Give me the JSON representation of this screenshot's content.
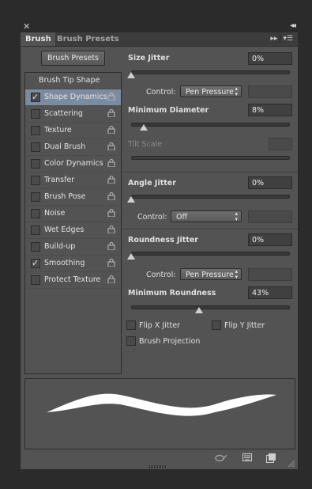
{
  "panel": {
    "close_glyph": "✕",
    "collapse_glyph": "◂◂",
    "tabs": [
      {
        "label": "Brush",
        "active": true
      },
      {
        "label": "Brush Presets",
        "active": false
      }
    ],
    "menu_glyph": "▸▸"
  },
  "brush_presets_button": "Brush Presets",
  "list": {
    "header": "Brush Tip Shape",
    "items": [
      {
        "label": "Shape Dynamics",
        "checked": true,
        "selected": true
      },
      {
        "label": "Scattering",
        "checked": false
      },
      {
        "label": "Texture",
        "checked": false
      },
      {
        "label": "Dual Brush",
        "checked": false
      },
      {
        "label": "Color Dynamics",
        "checked": false
      },
      {
        "label": "Transfer",
        "checked": false
      },
      {
        "label": "Brush Pose",
        "checked": false
      },
      {
        "label": "Noise",
        "checked": false
      },
      {
        "label": "Wet Edges",
        "checked": false
      },
      {
        "label": "Build-up",
        "checked": false
      },
      {
        "label": "Smoothing",
        "checked": true
      },
      {
        "label": "Protect Texture",
        "checked": false
      }
    ]
  },
  "settings": {
    "size_jitter": {
      "label": "Size Jitter",
      "value": "0%",
      "slider": 0.0
    },
    "size_control": {
      "label": "Control:",
      "value": "Pen Pressure"
    },
    "min_diameter": {
      "label": "Minimum Diameter",
      "value": "8%",
      "slider": 0.08
    },
    "tilt_scale": {
      "label": "Tilt Scale",
      "value": ""
    },
    "angle_jitter": {
      "label": "Angle Jitter",
      "value": "0%",
      "slider": 0.0
    },
    "angle_control": {
      "label": "Control:",
      "value": "Off"
    },
    "roundness_jitter": {
      "label": "Roundness Jitter",
      "value": "0%",
      "slider": 0.0
    },
    "roundness_control": {
      "label": "Control:",
      "value": "Pen Pressure"
    },
    "min_roundness": {
      "label": "Minimum Roundness",
      "value": "43%",
      "slider": 0.43
    },
    "flip_x": {
      "label": "Flip X Jitter",
      "checked": false
    },
    "flip_y": {
      "label": "Flip Y Jitter",
      "checked": false
    },
    "brush_projection": {
      "label": "Brush Projection",
      "checked": false
    }
  },
  "colors": {
    "panel_bg": "#535353",
    "selection": "#7c8ca0",
    "field_bg": "#404040"
  }
}
